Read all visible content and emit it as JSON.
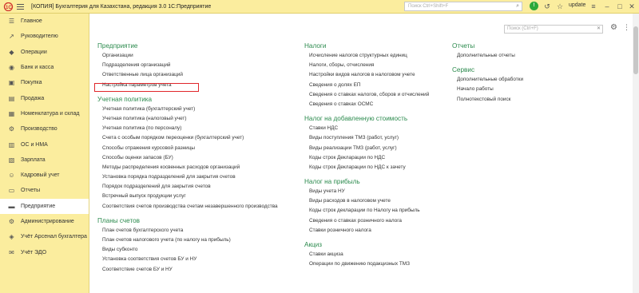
{
  "titlebar": {
    "title": "[КОПИЯ] Бухгалтерия для Казахстана, редакция 3.0 1С:Предприятие",
    "search_placeholder": "Поиск Ctrl+Shift+F",
    "notification_count": "1",
    "user": "update"
  },
  "sidebar": {
    "items": [
      {
        "label": "Главное",
        "icon": "menu-icon"
      },
      {
        "label": "Руководителю",
        "icon": "trend-icon"
      },
      {
        "label": "Операции",
        "icon": "operations-icon"
      },
      {
        "label": "Банк и касса",
        "icon": "bank-icon"
      },
      {
        "label": "Покупка",
        "icon": "cart-icon"
      },
      {
        "label": "Продажа",
        "icon": "sale-icon"
      },
      {
        "label": "Номенклатура и склад",
        "icon": "warehouse-icon"
      },
      {
        "label": "Производство",
        "icon": "production-icon"
      },
      {
        "label": "ОС и НМА",
        "icon": "assets-icon"
      },
      {
        "label": "Зарплата",
        "icon": "salary-icon"
      },
      {
        "label": "Кадровый учет",
        "icon": "personnel-icon"
      },
      {
        "label": "Отчеты",
        "icon": "reports-icon"
      },
      {
        "label": "Предприятие",
        "icon": "enterprise-icon"
      },
      {
        "label": "Администрирование",
        "icon": "admin-icon"
      },
      {
        "label": "Учёт Арсенал бухгалтера",
        "icon": "arsenal-icon"
      },
      {
        "label": "Учёт ЭДО",
        "icon": "edo-icon"
      }
    ],
    "active_index": 12
  },
  "main": {
    "search_placeholder": "Поиск (Ctrl+F)",
    "col1": {
      "sections": [
        {
          "title": "Предприятие",
          "links": [
            "Организации",
            "Подразделения организаций",
            "Ответственные лица организаций",
            "Настройка параметров учета"
          ]
        },
        {
          "title": "Учетная политика",
          "links": [
            "Учетная политика (бухгалтерский учет)",
            "Учетная политика (налоговый учет)",
            "Учетная политика (по персоналу)",
            "Счета с особым порядком переоценки (бухгалтерский учет)",
            "Способы отражения курсовой разницы",
            "Способы оценки запасов (БУ)",
            "Методы распределения косвенных расходов организаций",
            "Установка порядка подразделений для закрытия счетов",
            "Порядок подразделений для закрытия счетов",
            "Встречный выпуск продукции услуг",
            "Соответствия счетов производства счетам незавершенного производства"
          ]
        },
        {
          "title": "Планы счетов",
          "links": [
            "План счетов бухгалтерского учета",
            "План счетов налогового учета (по налогу на прибыль)",
            "Виды субконто",
            "Установка соответствия счетов БУ и НУ",
            "Соответствие счетов БУ и НУ"
          ]
        }
      ]
    },
    "col2": {
      "sections": [
        {
          "title": "Налоги",
          "links": [
            "Исчисление налогов структурных единиц",
            "Налоги, сборы, отчисления",
            "Настройки видов налогов в налоговом учете",
            "Сведения о долях ЕП",
            "Сведения о ставках налогов, сборов и отчислений",
            "Сведения о ставках ОСМС"
          ]
        },
        {
          "title": "Налог на добавленную стоимость",
          "links": [
            "Ставки НДС",
            "Виды поступления ТМЗ (работ, услуг)",
            "Виды реализации ТМЗ (работ, услуг)",
            "Коды строк Декларации по НДС",
            "Коды строк Декларации по НДС к зачету"
          ]
        },
        {
          "title": "Налог на прибыль",
          "links": [
            "Виды учета НУ",
            "Виды расходов в налоговом учете",
            "Коды строк декларации по Налогу на прибыль",
            "Сведения о ставках розничного налога",
            "Ставки розничного налога"
          ]
        },
        {
          "title": "Акциз",
          "links": [
            "Ставки акциза",
            "Операции по движению подакцизных ТМЗ"
          ]
        }
      ]
    },
    "col3": {
      "sections": [
        {
          "title": "Отчеты",
          "links": [
            "Дополнительные отчеты"
          ]
        },
        {
          "title": "Сервис",
          "links": [
            "Дополнительные обработки",
            "Начало работы",
            "Полнотекстовый поиск"
          ]
        }
      ]
    }
  },
  "colors": {
    "panel": "#fbed9e",
    "section_title": "#2b8a4d",
    "highlight": "#e0262b"
  }
}
